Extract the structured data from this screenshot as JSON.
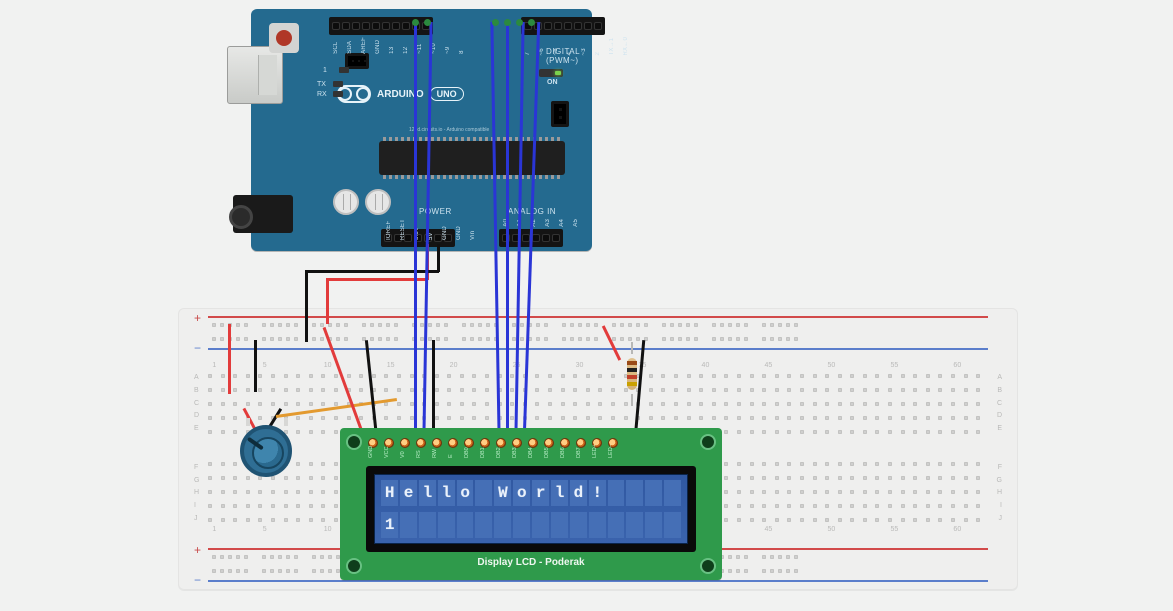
{
  "arduino": {
    "brand": "ARDUINO",
    "model": "UNO",
    "tiny_text": "123d.circuits.io - Arduino compatible",
    "leds": {
      "on": "ON"
    },
    "indicator": {
      "one": "1",
      "tx": "TX",
      "rx": "RX"
    },
    "section_labels": {
      "digital": "DIGITAL (PWM~)",
      "power": "POWER",
      "analog": "ANALOG IN"
    },
    "top_left_pins": [
      "SCL",
      "SDA",
      "AREF",
      "GND",
      "13",
      "12",
      "~11",
      "~10",
      "~9",
      "8"
    ],
    "top_right_pins": [
      "7",
      "~6",
      "~5",
      "4",
      "~3",
      "2",
      "TX→1",
      "RX←0"
    ],
    "bottom_left_pins": [
      "IOREF",
      "RESET",
      "3.3V",
      "5V",
      "GND",
      "GND",
      "Vin"
    ],
    "bottom_right_pins": [
      "A0",
      "A1",
      "A2",
      "A3",
      "A4",
      "A5"
    ]
  },
  "breadboard": {
    "rail_plus": "+",
    "rail_minus": "−",
    "row_letters_upper": [
      "A",
      "B",
      "C",
      "D",
      "E"
    ],
    "row_letters_lower": [
      "F",
      "G",
      "H",
      "I",
      "J"
    ],
    "col_first": 1,
    "col_step": 5,
    "col_last": 60
  },
  "components": {
    "potentiometer": {
      "type": "rotary-potentiometer"
    },
    "resistor": {
      "type": "resistor",
      "orientation": "vertical"
    }
  },
  "wires": [
    {
      "color": "red",
      "from": "Arduino 5V",
      "to": "breadboard + rail"
    },
    {
      "color": "black",
      "from": "Arduino GND",
      "to": "breadboard − rail"
    },
    {
      "color": "red",
      "from": "+ rail",
      "to": "pot left terminal"
    },
    {
      "color": "black",
      "from": "− rail",
      "to": "pot right terminal"
    },
    {
      "color": "orange",
      "from": "pot wiper",
      "to": "LCD V0"
    },
    {
      "color": "black",
      "from": "− rail",
      "to": "LCD GND"
    },
    {
      "color": "red",
      "from": "+ rail",
      "to": "LCD VCC"
    },
    {
      "color": "black",
      "from": "− rail",
      "to": "LCD RW"
    },
    {
      "color": "blue",
      "from": "Arduino 12",
      "to": "LCD RS"
    },
    {
      "color": "blue",
      "from": "Arduino 11",
      "to": "LCD E"
    },
    {
      "color": "blue",
      "from": "Arduino 5",
      "to": "LCD DB4"
    },
    {
      "color": "blue",
      "from": "Arduino 4",
      "to": "LCD DB5"
    },
    {
      "color": "blue",
      "from": "Arduino 3",
      "to": "LCD DB6"
    },
    {
      "color": "blue",
      "from": "Arduino 2",
      "to": "LCD DB7"
    },
    {
      "color": "red",
      "from": "+ rail",
      "to": "LCD LED+ via resistor"
    },
    {
      "color": "black",
      "from": "− rail",
      "to": "LCD LED−"
    }
  ],
  "lcd": {
    "pins": [
      "GND",
      "VCC",
      "V0",
      "RS",
      "RW",
      "E",
      "DB0",
      "DB1",
      "DB2",
      "DB3",
      "DB4",
      "DB5",
      "DB6",
      "DB7",
      "LED+",
      "LED−"
    ],
    "cols": 16,
    "rows": 2,
    "line1": "Hello World!",
    "line2": "1",
    "caption": "Display LCD  - Poderak"
  }
}
